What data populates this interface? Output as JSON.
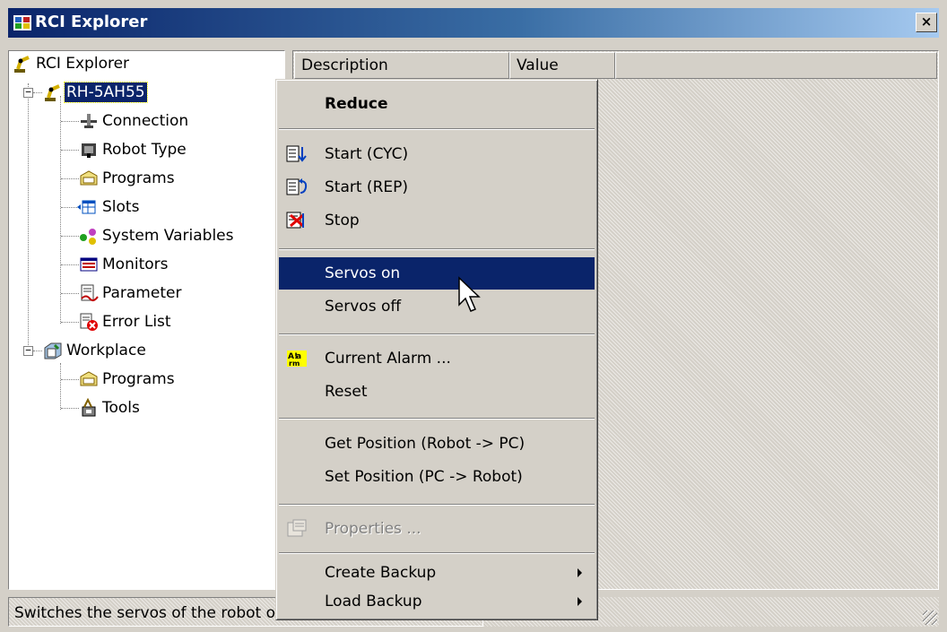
{
  "window": {
    "title": "RCI Explorer",
    "close_label": "×"
  },
  "tree": {
    "root": "RCI Explorer",
    "robot": "RH-5AH55",
    "robot_children": [
      "Connection",
      "Robot Type",
      "Programs",
      "Slots",
      "System Variables",
      "Monitors",
      "Parameter",
      "Error List"
    ],
    "workplace": "Workplace",
    "workplace_children": [
      "Programs",
      "Tools"
    ],
    "expander_minus": "−"
  },
  "list": {
    "columns": [
      "Description",
      "Value"
    ]
  },
  "status": {
    "text": "Switches the servos of the robot on"
  },
  "menu": {
    "items": [
      {
        "label": "Reduce",
        "bold": true
      },
      {
        "label": "Start (CYC)",
        "icon": "start-cyc-icon"
      },
      {
        "label": "Start (REP)",
        "icon": "start-rep-icon"
      },
      {
        "label": "Stop",
        "icon": "stop-icon"
      },
      {
        "label": "Servos on",
        "highlighted": true
      },
      {
        "label": "Servos off"
      },
      {
        "label": "Current Alarm ...",
        "icon": "alarm-icon"
      },
      {
        "label": "Reset"
      },
      {
        "label": "Get Position (Robot -> PC)"
      },
      {
        "label": "Set Position (PC -> Robot)"
      },
      {
        "label": "Properties ...",
        "disabled": true,
        "icon": "properties-icon"
      },
      {
        "label": "Create Backup",
        "submenu": true
      },
      {
        "label": "Load Backup",
        "submenu": true
      }
    ]
  },
  "colors": {
    "selection": "#0a246a",
    "face": "#d4d0c8",
    "title_start": "#0a246a",
    "title_end": "#a6caf0"
  }
}
